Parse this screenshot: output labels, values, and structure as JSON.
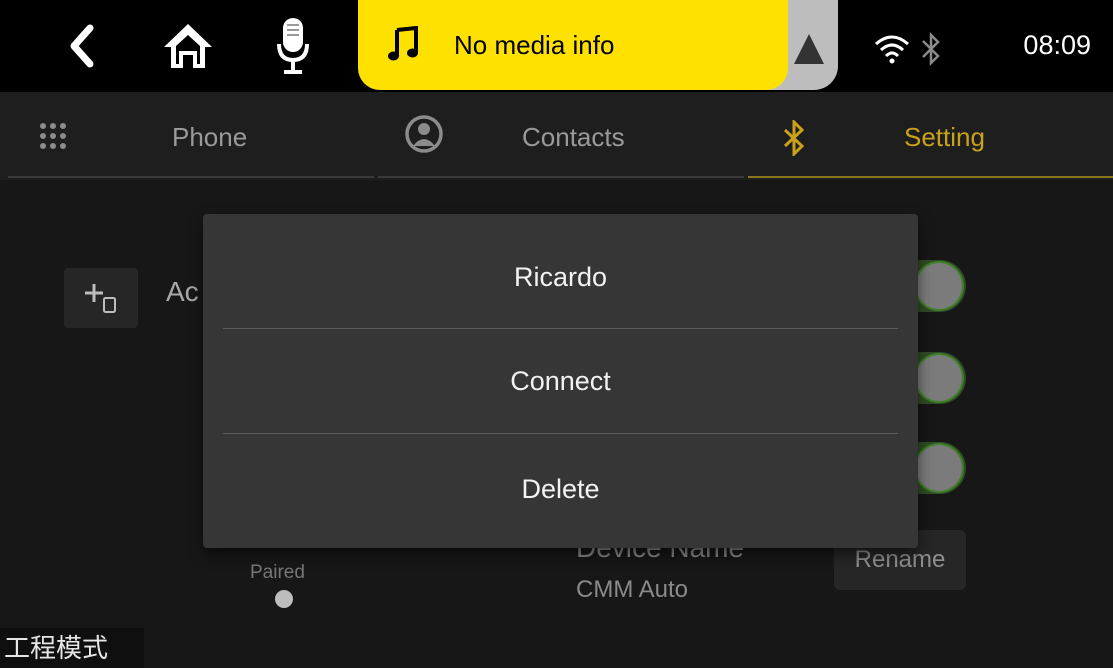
{
  "topbar": {
    "icons": [
      "back-icon",
      "home-icon",
      "microphone-icon",
      "music-note-icon",
      "navigation-arrow-icon",
      "wifi-icon",
      "bluetooth-icon"
    ],
    "media_text": "No media info",
    "time": "08:09",
    "colors": {
      "media_bg": "#ffe100",
      "nav_bg": "#bdbdbd"
    }
  },
  "tabs": [
    {
      "label": "Phone",
      "icon": "dialpad-icon",
      "active": false
    },
    {
      "label": "Contacts",
      "icon": "contact-icon",
      "active": false
    },
    {
      "label": "Setting",
      "icon": "bluetooth-icon",
      "active": true
    }
  ],
  "settings": {
    "add_label": "Ac",
    "paired_label": "Paired",
    "device_name_label": "Device Name",
    "device_name_value": "CMM Auto",
    "rename_label": "Rename"
  },
  "dialog": {
    "title": "Ricardo",
    "items": [
      "Connect",
      "Delete"
    ]
  },
  "footer": {
    "engineering_mode": "工程模式"
  },
  "colors": {
    "accent": "#c9a21a",
    "toggle_on": "#3f7f2a"
  }
}
